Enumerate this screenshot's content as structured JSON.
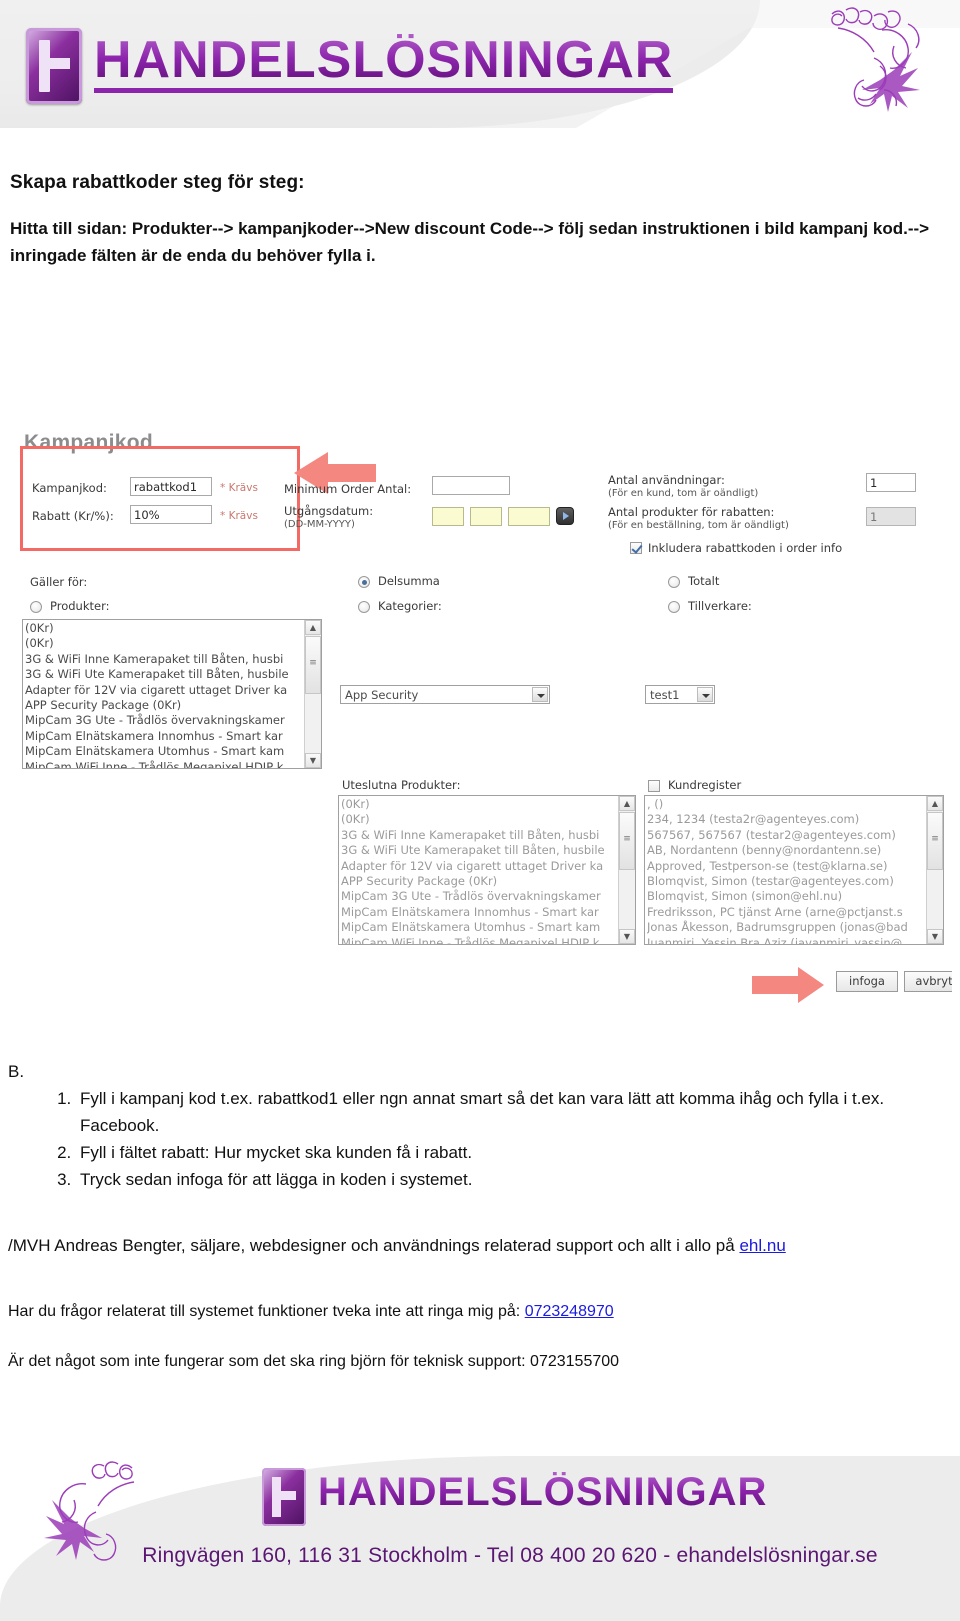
{
  "header": {
    "brand": "HANDELSLÖSNINGAR",
    "logo_icon": "e-monogram-logo",
    "flourish_icon": "floral-butterfly-ornament"
  },
  "doc": {
    "title": "Skapa rabattkoder steg för steg:",
    "intro": "Hitta till sidan:  Produkter--> kampanjkoder-->New discount Code--> följ sedan instruktionen i bild kampanj kod.--> inringade fälten är de enda du behöver fylla i.",
    "section_b_label": "B.",
    "steps": [
      "Fyll i kampanj kod t.ex. rabattkod1 eller ngn annat smart så det kan vara lätt att komma ihåg och fylla i t.ex. Facebook.",
      "Fyll i fältet rabatt: Hur mycket ska kunden få i rabatt.",
      "Tryck sedan infoga för att lägga in koden i systemet."
    ],
    "signoff_text": "/MVH Andreas Bengter, säljare, webdesigner och användnings relaterad support och allt i allo på ",
    "signoff_link": "ehl.nu",
    "contact_line1_prefix": "Har du frågor relaterat till systemet funktioner tveka inte att ringa mig på: ",
    "contact_line1_phone": "0723248970",
    "contact_line2_prefix": "Är det något som inte fungerar som det ska ring björn för teknisk support:  ",
    "contact_line2_phone": "0723155700"
  },
  "screenshot": {
    "panel_title": "Kampanjkod",
    "highlight_color": "#f26a63",
    "fields": {
      "code_label": "Kampanjkod:",
      "code_value": "rabattkod1",
      "code_required": "* Krävs",
      "discount_label": "Rabatt (Kr/%):",
      "discount_value": "10%",
      "discount_required": "* Krävs",
      "min_order_label": "Minimum Order Antal:",
      "min_order_value": "",
      "expiry_label": "Utgångsdatum:",
      "expiry_sub": "(DD-MM-YYYY)",
      "expiry_d": "",
      "expiry_m": "",
      "expiry_y": "",
      "usages_label": "Antal användningar:",
      "usages_sub": "(För en kund, tom är oändligt)",
      "usages_value": "1",
      "products_for_discount_label": "Antal produkter för rabatten:",
      "products_for_discount_sub": "(För en beställning, tom är oändligt)",
      "products_for_discount_value": "1",
      "include_code_label": "Inkludera rabattkoden i order info",
      "include_code_checked": true
    },
    "applies": {
      "group_label": "Gäller för:",
      "options": [
        {
          "label": "Delsumma",
          "selected": true
        },
        {
          "label": "Totalt",
          "selected": false
        },
        {
          "label": "Produkter:",
          "selected": false
        },
        {
          "label": "Kategorier:",
          "selected": false
        },
        {
          "label": "Tillverkare:",
          "selected": false
        }
      ]
    },
    "product_list": [
      "(0Kr)",
      "(0Kr)",
      "3G & WiFi Inne Kamerapaket till Båten, husbi",
      "3G & WiFi Ute Kamerapaket till Båten, husbile",
      "Adapter för 12V via cigarett uttaget Driver ka",
      "APP Security Package (0Kr)",
      "MipCam 3G Ute - Trådlös övervakningskamer",
      "MipCam Elnätskamera Innomhus - Smart kar",
      "MipCam Elnätskamera Utomhus - Smart kam",
      "MipCam WiFi Inne - Trådlös Megapixel HDIP k"
    ],
    "category_select_value": "App Security",
    "manufacturer_select_value": "test1",
    "excluded_label": "Uteslutna Produkter:",
    "excluded_list": [
      "(0Kr)",
      "(0Kr)",
      "3G & WiFi Inne Kamerapaket till Båten, husbi",
      "3G & WiFi Ute Kamerapaket till Båten, husbile",
      "Adapter för 12V via cigarett uttaget Driver ka",
      "APP Security Package (0Kr)",
      "MipCam 3G Ute - Trådlös övervakningskamer",
      "MipCam Elnätskamera Innomhus - Smart kar",
      "MipCam Elnätskamera Utomhus - Smart kam",
      "MipCam WiFi Inne - Trådlös Megapixel HDIP k"
    ],
    "customer_register_label": "Kundregister",
    "customer_register_checked": false,
    "customer_list": [
      ", ()",
      "234, 1234 (testa2r@agenteyes.com)",
      "567567, 567567 (testar2@agenteyes.com)",
      "AB, Nordantenn (benny@nordantenn.se)",
      "Approved, Testperson-se (test@klarna.se)",
      "Blomqvist, Simon (testar@agenteyes.com)",
      "Blomqvist, Simon (simon@ehl.nu)",
      "Fredriksson, PC tjänst Arne (arne@pctjanst.s",
      "Jonas Åkesson, Badrumsgruppen (jonas@bad",
      "Juanmiri, Yassin Bra Aziz (javanmiri_yassin@"
    ],
    "buttons": {
      "submit": "infoga",
      "cancel": "avbryt"
    },
    "arrow_icon": "left-arrow-annotation",
    "arrow_icon_2": "right-arrow-annotation"
  },
  "footer": {
    "brand": "HANDELSLÖSNINGAR",
    "address": "Ringvägen 160, 116 31 Stockholm - Tel 08 400 20 620 - ehandelslösningar.se",
    "flourish_icon": "floral-butterfly-ornament"
  }
}
